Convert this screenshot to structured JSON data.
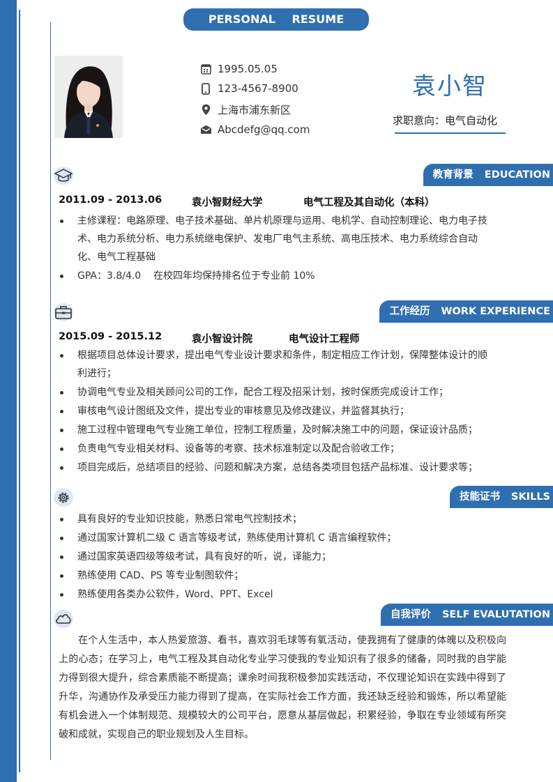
{
  "banner": {
    "left": "PERSONAL",
    "right": "RESUME"
  },
  "profile": {
    "birth": "1995.05.05",
    "phone": "123-4567-8900",
    "address": "上海市浦东新区",
    "email": "Abcdefg@qq.com",
    "name": "袁小智",
    "job_intention": "求职意向：电气自动化"
  },
  "education": {
    "tag_cn": "教育背景",
    "tag_en": "EDUCATION",
    "period": "2011.09 - 2013.06",
    "school": "袁小智财经大学",
    "major": "电气工程及其自动化（本科）",
    "items": [
      "主修课程：电路原理、电子技术基础、单片机原理与运用、电机学、自动控制理论、电力电子技术、电力系统分析、电力系统继电保护、发电厂电气主系统、高电压技术、电力系统综合自动化、电气工程基础",
      "GPA：3.8/4.0    在校四年均保持排名位于专业前 10%"
    ]
  },
  "work": {
    "tag_cn": "工作经历",
    "tag_en": "WORK EXPERIENCE",
    "period": "2015.09 - 2015.12",
    "company": "袁小智设计院",
    "position": "电气设计工程师",
    "items": [
      "根据项目总体设计要求，提出电气专业设计要求和条件，制定相应工作计划，保障整体设计的顺利进行；",
      "协调电气专业及相关顾问公司的工作，配合工程及招采计划，按时保质完成设计工作；",
      "审核电气设计图纸及文件，提出专业的审核意见及修改建议，并监督其执行；",
      "施工过程中管理电气专业施工单位，控制工程质量，及时解决施工中的问题，保证设计品质；",
      "负责电气专业相关材料、设备等的考察、技术标准制定以及配合验收工作；",
      "项目完成后，总结项目的经验、问题和解决方案，总结各类项目包括产品标准、设计要求等；"
    ]
  },
  "skills": {
    "tag_cn": "技能证书",
    "tag_en": "SKILLS",
    "items": [
      "具有良好的专业知识技能，熟悉日常电气控制技术；",
      "通过国家计算机二级 C 语言等级考试，熟练使用计算机 C 语言编程软件；",
      "通过国家英语四级等级考试，具有良好的听，说，译能力；",
      "熟练使用 CAD、PS 等专业制图软件；",
      "熟练使用各类办公软件，Word、PPT、Excel"
    ]
  },
  "self_eval": {
    "tag_cn": "自我评价",
    "tag_en": "SELF EVALUTATION",
    "text": "在个人生活中，本人热爱旅游、看书，喜欢羽毛球等有氧活动，使我拥有了健康的体魄以及积极向上的心态；在学习上，电气工程及其自动化专业学习使我的专业知识有了很多的储备，同时我的自学能力得到很大提升，综合素质能不断提高；课余时间我积极参加实践活动，不仅理论知识在实践中得到了升华，沟通协作及承受压力能力得到了提高，在实际社会工作方面，我还缺乏经验和锻炼，所以希望能有机会进入一个体制规范、规模较大的公司平台，愿意从基层做起，积累经验，争取在专业领域有所突破和成就，实现自己的职业规划及人生目标。"
  },
  "icons": {
    "birth": "calendar-icon",
    "phone": "phone-icon",
    "address": "location-pin-icon",
    "email": "mail-icon",
    "education": "graduation-cap-icon",
    "work": "briefcase-icon",
    "skills": "gear-icon",
    "self_eval": "cloud-icon"
  },
  "colors": {
    "accent": "#2f6fb0",
    "icon_bg": "#dde6f2"
  }
}
